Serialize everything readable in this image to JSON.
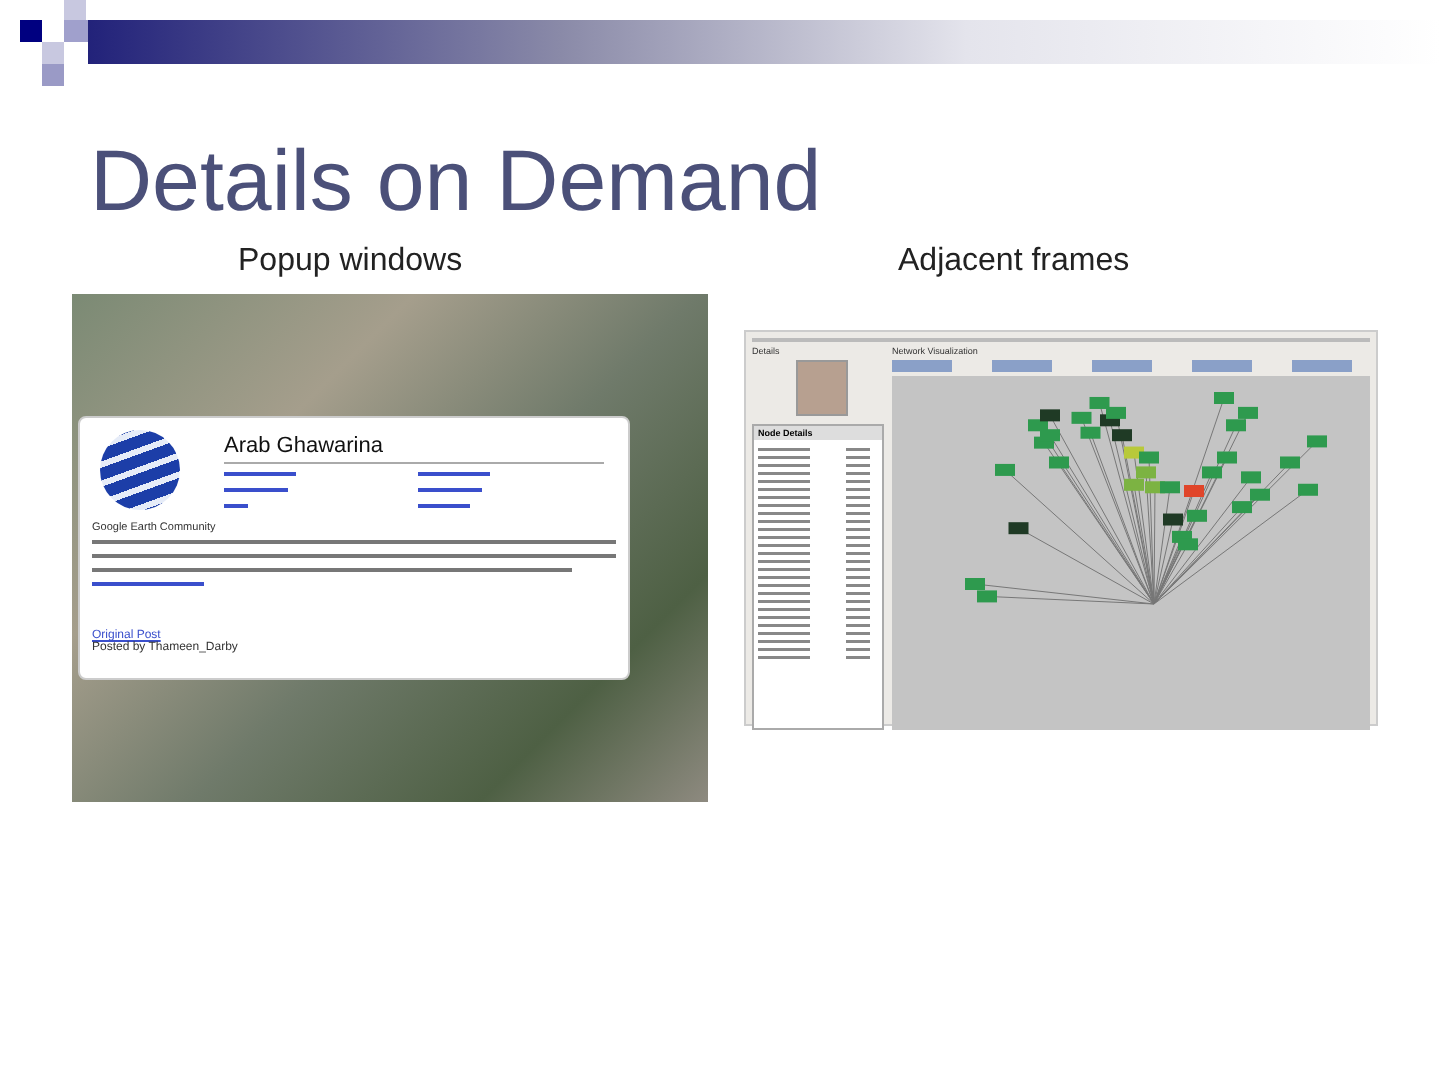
{
  "slide": {
    "title": "Details on Demand"
  },
  "panels": [
    {
      "caption": "Popup windows"
    },
    {
      "caption": "Adjacent frames"
    }
  ],
  "popup": {
    "title": "Arab Ghawarina",
    "source": "Google Earth Community",
    "link": "Original Post",
    "byline": "Posted by Thameen_Darby"
  },
  "frames": {
    "details_label": "Details",
    "node_panel_title": "Node Details",
    "network_label": "Network Visualization"
  }
}
